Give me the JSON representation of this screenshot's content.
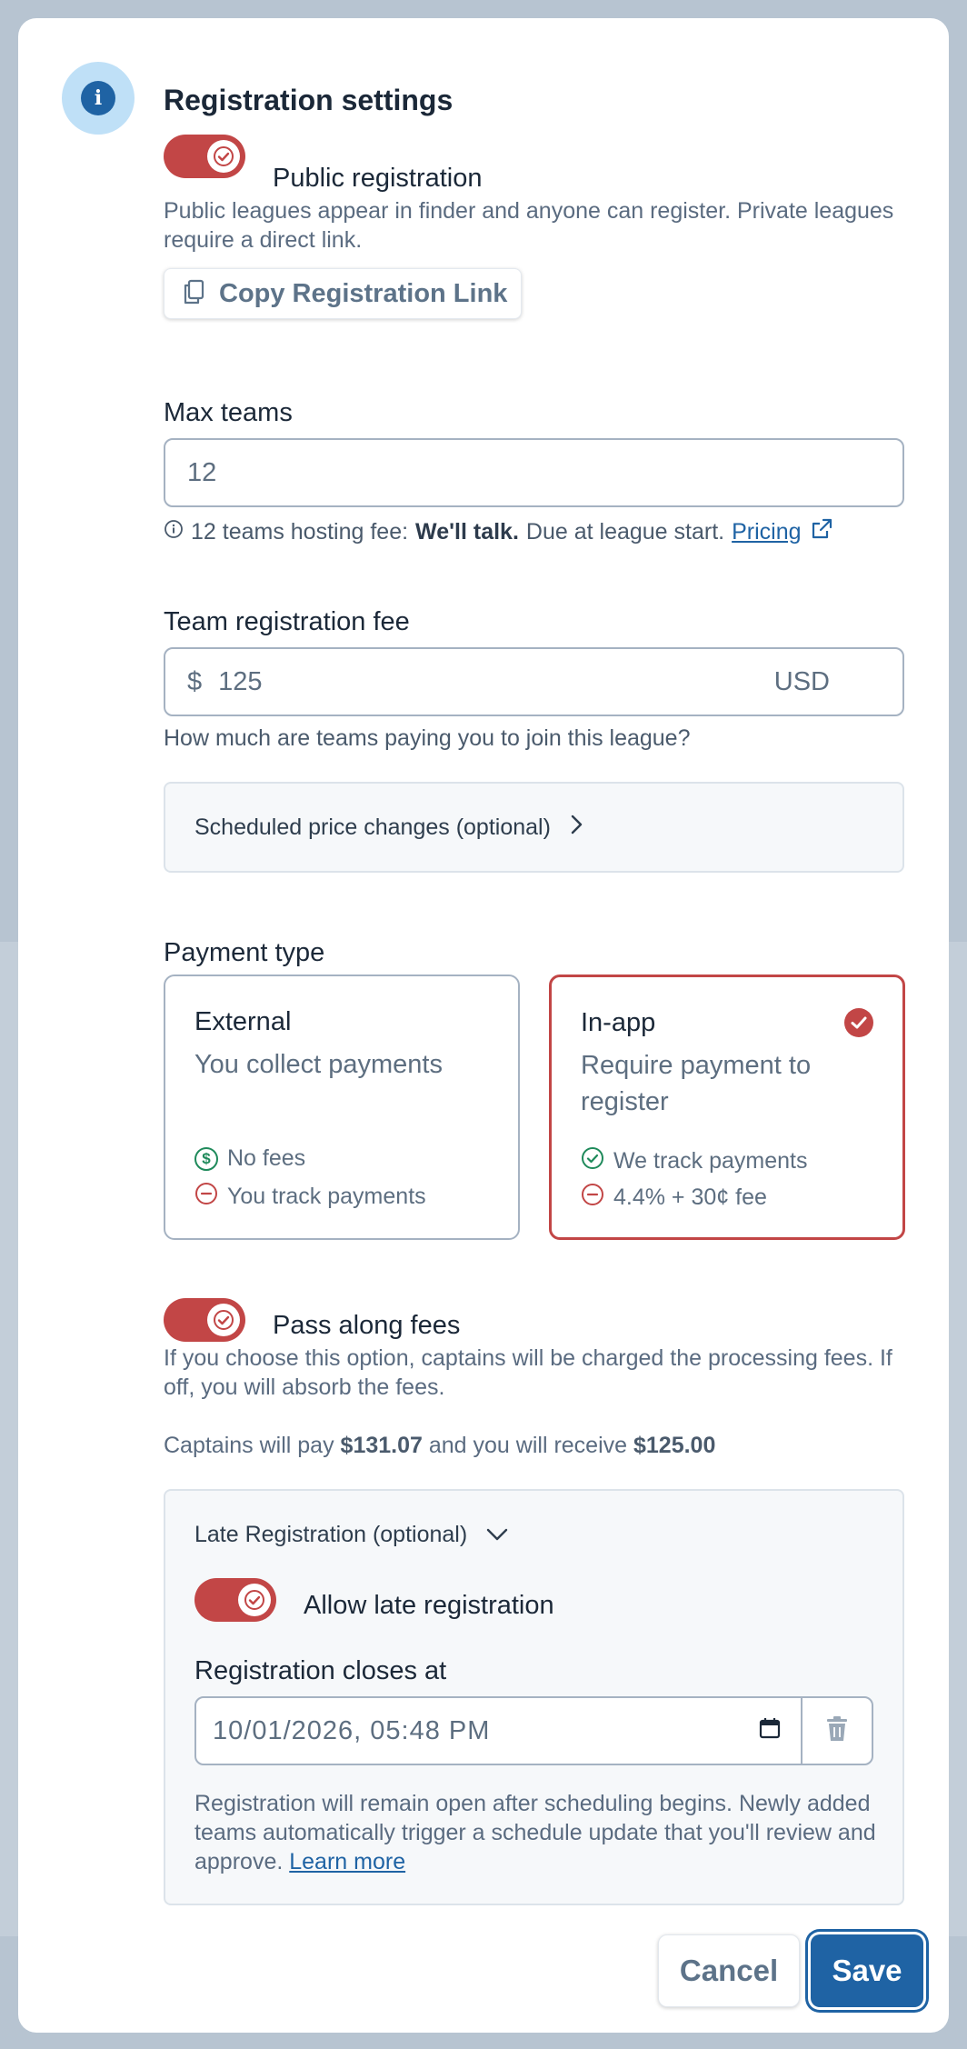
{
  "modal": {
    "title": "Registration settings",
    "info_icon": "info-icon"
  },
  "public_registration": {
    "label": "Public registration",
    "enabled": true,
    "description": "Public leagues appear in finder and anyone can register. Private leagues require a direct link.",
    "copy_button": "Copy Registration Link"
  },
  "max_teams": {
    "label": "Max teams",
    "value": "12",
    "hint_prefix": "12 teams hosting fee:",
    "hint_bold": "We'll talk.",
    "hint_suffix": "Due at league start.",
    "pricing_link": "Pricing"
  },
  "team_fee": {
    "label": "Team registration fee",
    "currency_symbol": "$",
    "value": "125",
    "currency": "USD",
    "hint": "How much are teams paying you to join this league?",
    "scheduled_changes": "Scheduled price changes (optional)"
  },
  "payment_type": {
    "label": "Payment type",
    "options": [
      {
        "title": "External",
        "desc": "You collect payments",
        "pro": "No fees",
        "con": "You track payments",
        "selected": false
      },
      {
        "title": "In-app",
        "desc": "Require payment to register",
        "pro": "We track payments",
        "con": "4.4% + 30¢ fee",
        "selected": true
      }
    ]
  },
  "pass_fees": {
    "label": "Pass along fees",
    "enabled": true,
    "description": "If you choose this option, captains will be charged the processing fees. If off, you will absorb the fees.",
    "summary_prefix": "Captains will pay",
    "captain_pays": "$131.07",
    "summary_mid": "and you will receive",
    "you_receive": "$125.00"
  },
  "late_registration": {
    "header": "Late Registration (optional)",
    "toggle_label": "Allow late registration",
    "enabled": true,
    "closes_label": "Registration closes at",
    "closes_value": "10/01/2026, 05:48 PM",
    "note": "Registration will remain open after scheduling begins. Newly added teams automatically trigger a schedule update that you'll review and approve.",
    "learn_more": "Learn more"
  },
  "actions": {
    "cancel": "Cancel",
    "save": "Save"
  },
  "colors": {
    "accent_red": "#c24646",
    "primary_blue": "#1f63a4",
    "success_green": "#1f8a5b"
  }
}
